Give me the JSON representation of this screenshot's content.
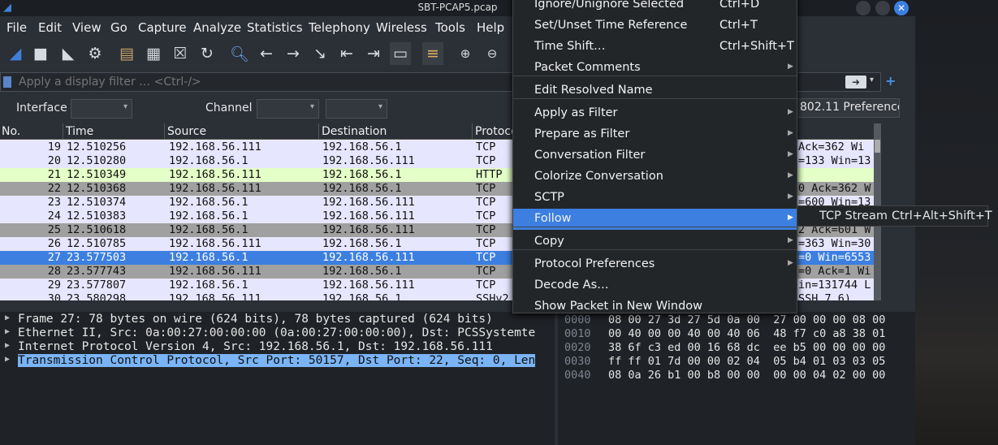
{
  "window": {
    "title": "SBT-PCAP5.pcap"
  },
  "menu": [
    "File",
    "Edit",
    "View",
    "Go",
    "Capture",
    "Analyze",
    "Statistics",
    "Telephony",
    "Wireless",
    "Tools",
    "Help"
  ],
  "filter": {
    "placeholder": "Apply a display filter … <Ctrl-/>"
  },
  "wireless_bar": {
    "interface_label": "Interface",
    "channel_label": "Channel",
    "preferences_button": "802.11 Preferences"
  },
  "packet_list": {
    "headers": [
      "No.",
      "Time",
      "Source",
      "Destination",
      "Protoco"
    ],
    "rows": [
      {
        "no": "19",
        "time": "12.510256",
        "src": "192.168.56.111",
        "dst": "192.168.56.1",
        "proto": "TCP",
        "info": "Ack=362 Wi"
      },
      {
        "no": "20",
        "time": "12.510280",
        "src": "192.168.56.1",
        "dst": "192.168.56.111",
        "proto": "TCP",
        "info": "=133 Win=13"
      },
      {
        "no": "21",
        "time": "12.510349",
        "src": "192.168.56.111",
        "dst": "192.168.56.1",
        "proto": "HTTP",
        "info": ""
      },
      {
        "no": "22",
        "time": "12.510368",
        "src": "192.168.56.111",
        "dst": "192.168.56.1",
        "proto": "TCP",
        "info": "0 Ack=362 W"
      },
      {
        "no": "23",
        "time": "12.510374",
        "src": "192.168.56.1",
        "dst": "192.168.56.111",
        "proto": "TCP",
        "info": "=600 Win=13"
      },
      {
        "no": "24",
        "time": "12.510383",
        "src": "192.168.56.1",
        "dst": "192.168.56.111",
        "proto": "TCP",
        "info": "=363 Win=13"
      },
      {
        "no": "25",
        "time": "12.510618",
        "src": "192.168.56.1",
        "dst": "192.168.56.111",
        "proto": "TCP",
        "info": "2 Ack=601 W"
      },
      {
        "no": "26",
        "time": "12.510785",
        "src": "192.168.56.111",
        "dst": "192.168.56.1",
        "proto": "TCP",
        "info": "=363 Win=30"
      },
      {
        "no": "27",
        "time": "23.577503",
        "src": "192.168.56.1",
        "dst": "192.168.56.111",
        "proto": "TCP",
        "info": "=0 Win=6553"
      },
      {
        "no": "28",
        "time": "23.577743",
        "src": "192.168.56.111",
        "dst": "192.168.56.1",
        "proto": "TCP",
        "info": "=0 Ack=1 Wi"
      },
      {
        "no": "29",
        "time": "23.577807",
        "src": "192.168.56.1",
        "dst": "192.168.56.111",
        "proto": "TCP",
        "info": "in=131744 L"
      },
      {
        "no": "30",
        "time": "23.580298",
        "src": "192.168.56.111",
        "dst": "192.168.56.1",
        "proto": "SSHv2",
        "info": "SSH 7.6)"
      }
    ]
  },
  "details": [
    "Frame 27: 78 bytes on wire (624 bits), 78 bytes captured (624 bits)",
    "Ethernet II, Src: 0a:00:27:00:00:00 (0a:00:27:00:00:00), Dst: PCSSystemte",
    "Internet Protocol Version 4, Src: 192.168.56.1, Dst: 192.168.56.111",
    "Transmission Control Protocol, Src Port: 50157, Dst Port: 22, Seq: 0, Len"
  ],
  "bytes": [
    {
      "offset": "0000",
      "hex": "08 00 27 3d 27 5d 0a 00  27 00 00 00 08 00"
    },
    {
      "offset": "0010",
      "hex": "00 40 00 00 40 00 40 06  48 f7 c0 a8 38 01"
    },
    {
      "offset": "0020",
      "hex": "38 6f c3 ed 00 16 68 dc  ee b5 00 00 00 00"
    },
    {
      "offset": "0030",
      "hex": "ff ff 01 7d 00 00 02 04  05 b4 01 03 03 05"
    },
    {
      "offset": "0040",
      "hex": "08 0a 26 b1 00 b8 00 00  00 00 04 02 00 00"
    }
  ],
  "context_menu": {
    "items": [
      {
        "label": "Ignore/Unignore Selected",
        "shortcut": "Ctrl+D"
      },
      {
        "label": "Set/Unset Time Reference",
        "shortcut": "Ctrl+T"
      },
      {
        "label": "Time Shift…",
        "shortcut": "Ctrl+Shift+T"
      },
      {
        "label": "Packet Comments",
        "shortcut": ""
      },
      {
        "label": "Edit Resolved Name",
        "shortcut": ""
      },
      {
        "label": "Apply as Filter",
        "shortcut": ""
      },
      {
        "label": "Prepare as Filter",
        "shortcut": ""
      },
      {
        "label": "Conversation Filter",
        "shortcut": ""
      },
      {
        "label": "Colorize Conversation",
        "shortcut": ""
      },
      {
        "label": "SCTP",
        "shortcut": ""
      },
      {
        "label": "Follow",
        "shortcut": ""
      },
      {
        "label": "Copy",
        "shortcut": ""
      },
      {
        "label": "Protocol Preferences",
        "shortcut": ""
      },
      {
        "label": "Decode As…",
        "shortcut": ""
      },
      {
        "label": "Show Packet in New Window",
        "shortcut": ""
      }
    ]
  },
  "submenu": {
    "label": "TCP Stream",
    "shortcut": "Ctrl+Alt+Shift+T"
  }
}
